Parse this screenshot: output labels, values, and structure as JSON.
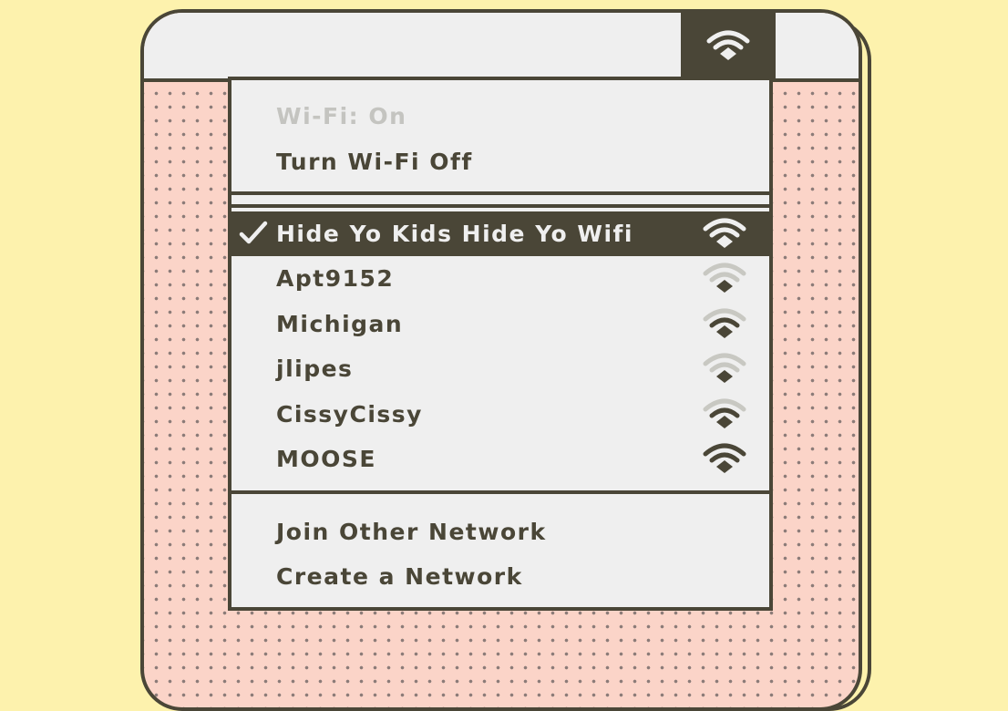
{
  "colors": {
    "background": "#fdf2ad",
    "ink": "#4a4637",
    "menu_background": "#efefef",
    "disabled_text": "#c4c4c0",
    "weak_signal": "#c8c8c2",
    "dotted_panel": "#fbd4c8"
  },
  "menubar": {
    "wifi_icon": "wifi-icon",
    "wifi_active": true
  },
  "menu": {
    "status_label": "Wi-Fi: On",
    "toggle_label": "Turn Wi-Fi Off",
    "networks": [
      {
        "name": "Hide Yo Kids Hide Yo Wifi",
        "signal_bars": 3,
        "connected": true
      },
      {
        "name": "Apt9152",
        "signal_bars": 1,
        "connected": false
      },
      {
        "name": "Michigan",
        "signal_bars": 2,
        "connected": false
      },
      {
        "name": "jlipes",
        "signal_bars": 1,
        "connected": false
      },
      {
        "name": "CissyCissy",
        "signal_bars": 2,
        "connected": false
      },
      {
        "name": "MOOSE",
        "signal_bars": 3,
        "connected": false
      }
    ],
    "join_other_label": "Join Other Network",
    "create_label": "Create a Network"
  }
}
